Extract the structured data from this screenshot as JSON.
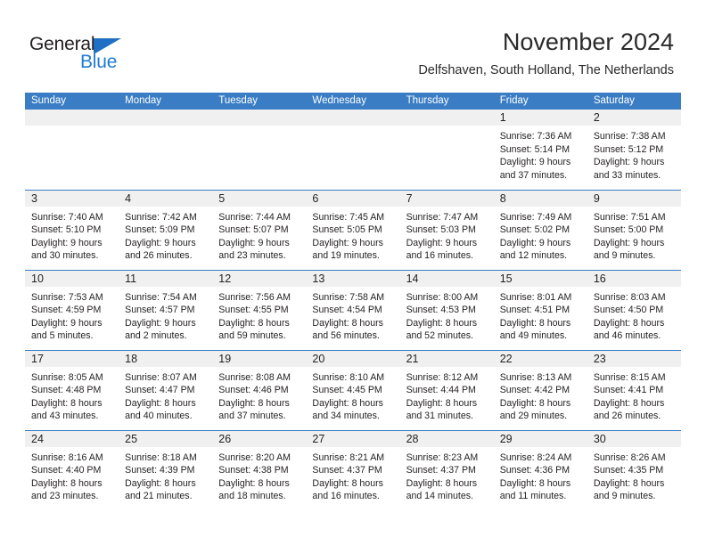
{
  "brand": {
    "name_top": "General",
    "name_bottom": "Blue",
    "triangle_icon": "triangle-icon",
    "color_dark": "#231f20",
    "color_blue": "#1f7ad4"
  },
  "header": {
    "title": "November 2024",
    "subtitle": "Delfshaven, South Holland, The Netherlands"
  },
  "theme": {
    "header_blue": "#3a7dc4",
    "daynum_strip": "#f0f0f0",
    "text": "#231f20"
  },
  "calendar": {
    "weekday_headers": [
      "Sunday",
      "Monday",
      "Tuesday",
      "Wednesday",
      "Thursday",
      "Friday",
      "Saturday"
    ],
    "weeks": [
      [
        {
          "day": "",
          "lines": []
        },
        {
          "day": "",
          "lines": []
        },
        {
          "day": "",
          "lines": []
        },
        {
          "day": "",
          "lines": []
        },
        {
          "day": "",
          "lines": []
        },
        {
          "day": "1",
          "lines": [
            "Sunrise: 7:36 AM",
            "Sunset: 5:14 PM",
            "Daylight: 9 hours",
            "and 37 minutes."
          ]
        },
        {
          "day": "2",
          "lines": [
            "Sunrise: 7:38 AM",
            "Sunset: 5:12 PM",
            "Daylight: 9 hours",
            "and 33 minutes."
          ]
        }
      ],
      [
        {
          "day": "3",
          "lines": [
            "Sunrise: 7:40 AM",
            "Sunset: 5:10 PM",
            "Daylight: 9 hours",
            "and 30 minutes."
          ]
        },
        {
          "day": "4",
          "lines": [
            "Sunrise: 7:42 AM",
            "Sunset: 5:09 PM",
            "Daylight: 9 hours",
            "and 26 minutes."
          ]
        },
        {
          "day": "5",
          "lines": [
            "Sunrise: 7:44 AM",
            "Sunset: 5:07 PM",
            "Daylight: 9 hours",
            "and 23 minutes."
          ]
        },
        {
          "day": "6",
          "lines": [
            "Sunrise: 7:45 AM",
            "Sunset: 5:05 PM",
            "Daylight: 9 hours",
            "and 19 minutes."
          ]
        },
        {
          "day": "7",
          "lines": [
            "Sunrise: 7:47 AM",
            "Sunset: 5:03 PM",
            "Daylight: 9 hours",
            "and 16 minutes."
          ]
        },
        {
          "day": "8",
          "lines": [
            "Sunrise: 7:49 AM",
            "Sunset: 5:02 PM",
            "Daylight: 9 hours",
            "and 12 minutes."
          ]
        },
        {
          "day": "9",
          "lines": [
            "Sunrise: 7:51 AM",
            "Sunset: 5:00 PM",
            "Daylight: 9 hours",
            "and 9 minutes."
          ]
        }
      ],
      [
        {
          "day": "10",
          "lines": [
            "Sunrise: 7:53 AM",
            "Sunset: 4:59 PM",
            "Daylight: 9 hours",
            "and 5 minutes."
          ]
        },
        {
          "day": "11",
          "lines": [
            "Sunrise: 7:54 AM",
            "Sunset: 4:57 PM",
            "Daylight: 9 hours",
            "and 2 minutes."
          ]
        },
        {
          "day": "12",
          "lines": [
            "Sunrise: 7:56 AM",
            "Sunset: 4:55 PM",
            "Daylight: 8 hours",
            "and 59 minutes."
          ]
        },
        {
          "day": "13",
          "lines": [
            "Sunrise: 7:58 AM",
            "Sunset: 4:54 PM",
            "Daylight: 8 hours",
            "and 56 minutes."
          ]
        },
        {
          "day": "14",
          "lines": [
            "Sunrise: 8:00 AM",
            "Sunset: 4:53 PM",
            "Daylight: 8 hours",
            "and 52 minutes."
          ]
        },
        {
          "day": "15",
          "lines": [
            "Sunrise: 8:01 AM",
            "Sunset: 4:51 PM",
            "Daylight: 8 hours",
            "and 49 minutes."
          ]
        },
        {
          "day": "16",
          "lines": [
            "Sunrise: 8:03 AM",
            "Sunset: 4:50 PM",
            "Daylight: 8 hours",
            "and 46 minutes."
          ]
        }
      ],
      [
        {
          "day": "17",
          "lines": [
            "Sunrise: 8:05 AM",
            "Sunset: 4:48 PM",
            "Daylight: 8 hours",
            "and 43 minutes."
          ]
        },
        {
          "day": "18",
          "lines": [
            "Sunrise: 8:07 AM",
            "Sunset: 4:47 PM",
            "Daylight: 8 hours",
            "and 40 minutes."
          ]
        },
        {
          "day": "19",
          "lines": [
            "Sunrise: 8:08 AM",
            "Sunset: 4:46 PM",
            "Daylight: 8 hours",
            "and 37 minutes."
          ]
        },
        {
          "day": "20",
          "lines": [
            "Sunrise: 8:10 AM",
            "Sunset: 4:45 PM",
            "Daylight: 8 hours",
            "and 34 minutes."
          ]
        },
        {
          "day": "21",
          "lines": [
            "Sunrise: 8:12 AM",
            "Sunset: 4:44 PM",
            "Daylight: 8 hours",
            "and 31 minutes."
          ]
        },
        {
          "day": "22",
          "lines": [
            "Sunrise: 8:13 AM",
            "Sunset: 4:42 PM",
            "Daylight: 8 hours",
            "and 29 minutes."
          ]
        },
        {
          "day": "23",
          "lines": [
            "Sunrise: 8:15 AM",
            "Sunset: 4:41 PM",
            "Daylight: 8 hours",
            "and 26 minutes."
          ]
        }
      ],
      [
        {
          "day": "24",
          "lines": [
            "Sunrise: 8:16 AM",
            "Sunset: 4:40 PM",
            "Daylight: 8 hours",
            "and 23 minutes."
          ]
        },
        {
          "day": "25",
          "lines": [
            "Sunrise: 8:18 AM",
            "Sunset: 4:39 PM",
            "Daylight: 8 hours",
            "and 21 minutes."
          ]
        },
        {
          "day": "26",
          "lines": [
            "Sunrise: 8:20 AM",
            "Sunset: 4:38 PM",
            "Daylight: 8 hours",
            "and 18 minutes."
          ]
        },
        {
          "day": "27",
          "lines": [
            "Sunrise: 8:21 AM",
            "Sunset: 4:37 PM",
            "Daylight: 8 hours",
            "and 16 minutes."
          ]
        },
        {
          "day": "28",
          "lines": [
            "Sunrise: 8:23 AM",
            "Sunset: 4:37 PM",
            "Daylight: 8 hours",
            "and 14 minutes."
          ]
        },
        {
          "day": "29",
          "lines": [
            "Sunrise: 8:24 AM",
            "Sunset: 4:36 PM",
            "Daylight: 8 hours",
            "and 11 minutes."
          ]
        },
        {
          "day": "30",
          "lines": [
            "Sunrise: 8:26 AM",
            "Sunset: 4:35 PM",
            "Daylight: 8 hours",
            "and 9 minutes."
          ]
        }
      ]
    ]
  }
}
